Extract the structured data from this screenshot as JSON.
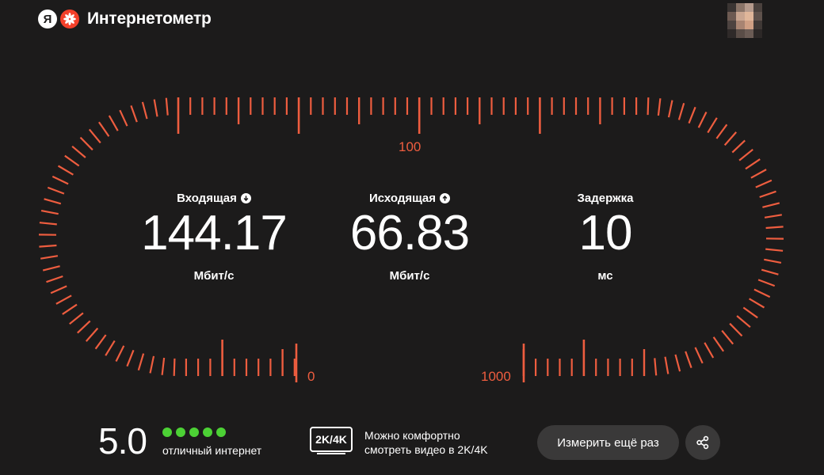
{
  "header": {
    "logo_letter": "Я",
    "title": "Интернетометр",
    "avatar_icon": "user-avatar-pixelated"
  },
  "gauge": {
    "accent_color": "#ee5d3f",
    "labels": {
      "top": "100",
      "bottom_left": "0",
      "bottom_right": "1000"
    }
  },
  "metrics": {
    "download": {
      "title": "Входящая",
      "value": "144.17",
      "unit": "Мбит/с",
      "icon": "arrow-down-icon"
    },
    "upload": {
      "title": "Исходящая",
      "value": "66.83",
      "unit": "Мбит/с",
      "icon": "arrow-up-icon"
    },
    "latency": {
      "title": "Задержка",
      "value": "10",
      "unit": "мс"
    }
  },
  "rating": {
    "score": "5.0",
    "stars_filled": 5,
    "stars_total": 5,
    "color": "#4cd135",
    "text": "отличный интернет"
  },
  "video": {
    "badge": "2K/4K",
    "line1": "Можно комфортно",
    "line2": "смотреть видео в 2K/4K"
  },
  "actions": {
    "remeasure_label": "Измерить ещё раз",
    "share_icon": "share-icon"
  }
}
